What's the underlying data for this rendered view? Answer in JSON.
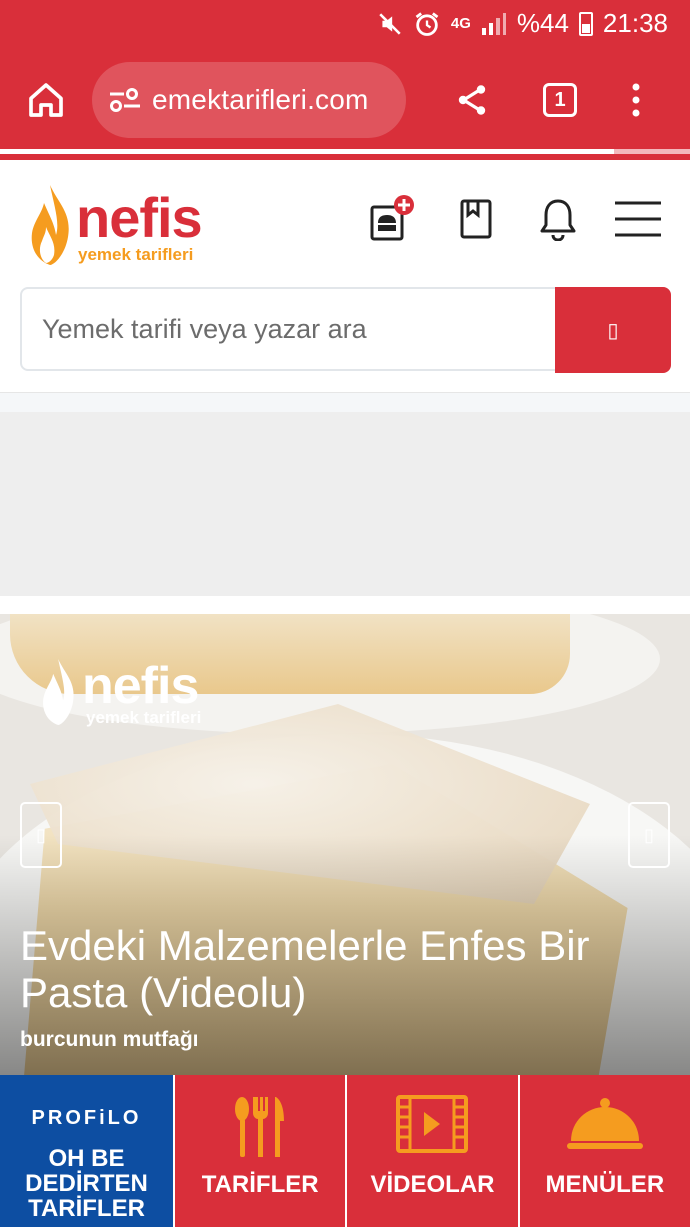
{
  "status_bar": {
    "battery": "%44",
    "time": "21:38",
    "network": "4G"
  },
  "browser": {
    "url": "emektarifleri.com",
    "tab_count": "1",
    "load_progress": 0.89
  },
  "site": {
    "logo_word": "nefis",
    "logo_sub": "yemek tarifleri",
    "search_placeholder": "Yemek tarifi veya yazar ara",
    "search_button_glyph": "▯"
  },
  "hero": {
    "watermark_word": "nefis",
    "watermark_sub": "yemek tarifleri",
    "title": "Evdeki Malzemelerle Enfes Bir Pasta (Videolu)",
    "author": "burcunun mutfağı",
    "prev_glyph": "▯",
    "next_glyph": "▯"
  },
  "bottom_nav": {
    "promo_brand": "PROFiLO",
    "promo_line1": "OH BE",
    "promo_line2": "DEDİRTEN",
    "promo_line3": "TARİFLER",
    "items": [
      {
        "label": "TARİFLER",
        "icon": "utensils-icon"
      },
      {
        "label": "VİDEOLAR",
        "icon": "video-icon"
      },
      {
        "label": "MENÜLER",
        "icon": "cloche-icon"
      }
    ]
  },
  "colors": {
    "brand_red": "#d92f3a",
    "brand_orange": "#f59c1f",
    "promo_blue": "#0d4ea2"
  }
}
